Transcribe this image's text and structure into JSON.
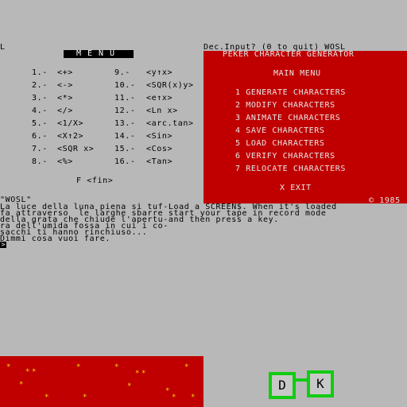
{
  "top_left_char": "L",
  "dec_input_prompt": "Dec.Input? (0 to quit) WOSL",
  "menu": {
    "title": "MENU",
    "items": [
      {
        "num": "1.-",
        "op": "<+>"
      },
      {
        "num": "2.-",
        "op": "<->"
      },
      {
        "num": "3.-",
        "op": "<*>"
      },
      {
        "num": "4.-",
        "op": "</>"
      },
      {
        "num": "5.-",
        "op": "<1/X>"
      },
      {
        "num": "6.-",
        "op": "<X↑2>"
      },
      {
        "num": "7.-",
        "op": "<SQR x>"
      },
      {
        "num": "8.-",
        "op": "<%>"
      },
      {
        "num": "9.-",
        "op": "<y↑x>"
      },
      {
        "num": "10.-",
        "op": "<SQR(x)y>"
      },
      {
        "num": "11.-",
        "op": "<e↑x>"
      },
      {
        "num": "12.-",
        "op": "<Ln x>"
      },
      {
        "num": "13.-",
        "op": "<arc.tan>"
      },
      {
        "num": "14.-",
        "op": "<Sin>"
      },
      {
        "num": "15.-",
        "op": "<Cos>"
      },
      {
        "num": "16.-",
        "op": "<Tan>"
      }
    ],
    "fin": "F <fin>"
  },
  "peker": {
    "title": "PEKER CHARACTER GENERATOR",
    "subtitle": "MAIN MENU",
    "options": [
      "1 GENERATE CHARACTERS",
      "2 MODIFY CHARACTERS",
      "3 ANIMATE CHARACTERS",
      "4 SAVE CHARACTERS",
      "5 LOAD CHARACTERS",
      "6 VERIFY CHARACTERS",
      "7 RELOCATE CHARACTERS"
    ],
    "exit": "X EXIT",
    "copyright": "© 1985"
  },
  "story": {
    "quote": "\"WOSL\"",
    "lines": [
      "La luce della luna piena si tuf-Load a SCREEN$. When it's loaded",
      "fa attraverso  le larghe sbarre start your tape in record mode",
      "della grata che chiude l'apertu-and then press a key.",
      "ra dell'umida fossa in cui i co-",
      "sacchi ti hanno rinchiuso...",
      "Dimmi cosa vuoi fare."
    ],
    "cursor": ">"
  },
  "keys": {
    "d": "D",
    "k": "K"
  },
  "colors": {
    "background": "#b8b8b8",
    "red": "#c00000",
    "green": "#11cc11",
    "star": "#f0e000"
  }
}
